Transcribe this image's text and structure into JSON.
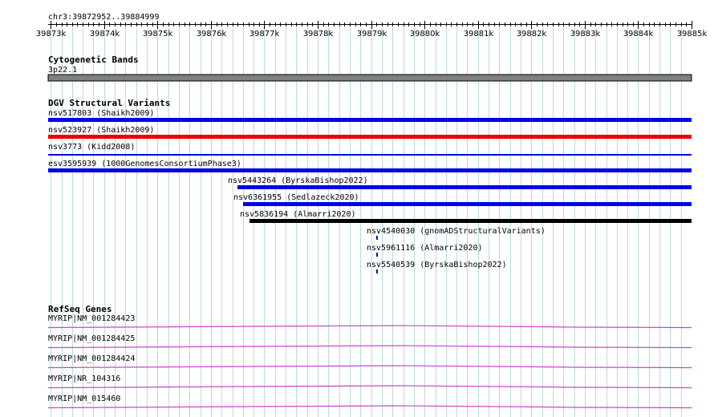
{
  "colors": {
    "grid": "#b7dbe3",
    "axis": "#000000",
    "cytoband": "#808080",
    "gain": "#0000ee",
    "loss": "#ee0000",
    "complex": "#000000",
    "gene": "#cc44cc"
  },
  "region": {
    "label": "chr3:39872952..39884999",
    "start": 39872952,
    "end": 39884999
  },
  "ruler": {
    "ticks": [
      "39873k",
      "39874k",
      "39875k",
      "39876k",
      "39877k",
      "39878k",
      "39879k",
      "39880k",
      "39881k",
      "39882k",
      "39883k",
      "39884k",
      "39885k"
    ]
  },
  "tracks": {
    "cytobands": {
      "title": "Cytogenetic Bands",
      "band": "3p22.1"
    },
    "dgv": {
      "title": "DGV Structural Variants",
      "features": [
        {
          "label": "nsv517803 (Shaikh2009)",
          "start": 39872952,
          "end": 39884999,
          "type": "gain",
          "height": "thick"
        },
        {
          "label": "nsv523927 (Shaikh2009)",
          "start": 39872952,
          "end": 39884999,
          "type": "loss",
          "height": "thick"
        },
        {
          "label": "nsv3773 (Kidd2008)",
          "start": 39872952,
          "end": 39884999,
          "type": "gain",
          "height": "thin"
        },
        {
          "label": "esv3595939 (1000GenomesConsortiumPhase3)",
          "start": 39872952,
          "end": 39884999,
          "type": "gain",
          "height": "thick"
        },
        {
          "label": "nsv5443264 (ByrskaBishop2022)",
          "start": 39876500,
          "end": 39884999,
          "type": "gain",
          "height": "thick"
        },
        {
          "label": "nsv6361955 (Sedlazeck2020)",
          "start": 39876600,
          "end": 39884999,
          "type": "gain",
          "height": "thick"
        },
        {
          "label": "nsv5836194 (Almarri2020)",
          "start": 39876720,
          "end": 39884999,
          "type": "complex",
          "height": "thick"
        },
        {
          "label": "nsv4540030 (gnomADStructuralVariants)",
          "start": 39879100,
          "end": 39879130,
          "type": "gain",
          "height": "thick"
        },
        {
          "label": "nsv5961116 (Almarri2020)",
          "start": 39879100,
          "end": 39879130,
          "type": "gain",
          "height": "thick"
        },
        {
          "label": "nsv5540539 (ByrskaBishop2022)",
          "start": 39879100,
          "end": 39879130,
          "type": "gain",
          "height": "thick"
        }
      ]
    },
    "refseq": {
      "title": "RefSeq Genes",
      "features": [
        {
          "label": "MYRIP|NM_001284423"
        },
        {
          "label": "MYRIP|NM_001284425"
        },
        {
          "label": "MYRIP|NM_001284424"
        },
        {
          "label": "MYRIP|NR_104316"
        },
        {
          "label": "MYRIP|NM_015460"
        }
      ]
    }
  }
}
